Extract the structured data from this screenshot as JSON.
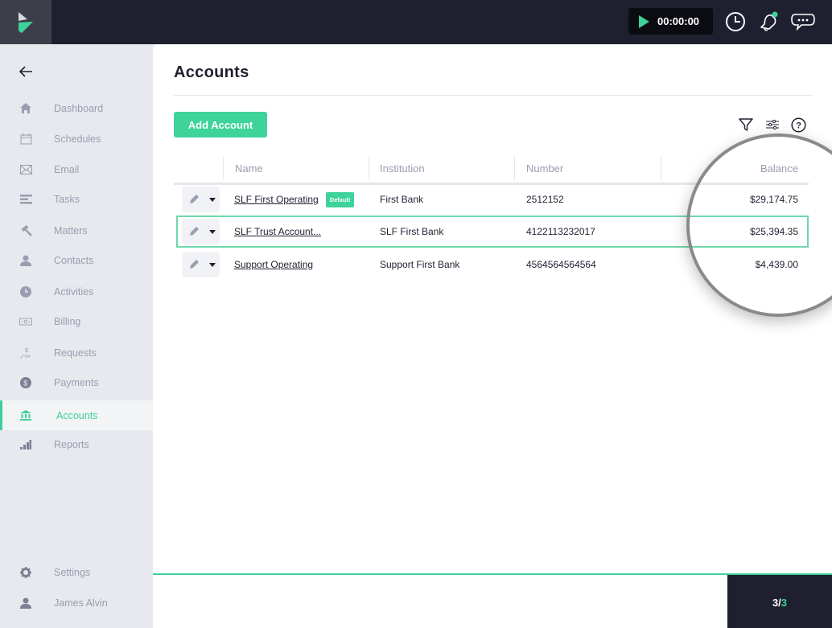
{
  "app": {
    "logo": "play-logo-icon"
  },
  "topbar": {
    "timer": "00:00:00",
    "icons": [
      "play-icon",
      "clock-icon",
      "bell-icon",
      "chat-icon"
    ],
    "notification_dot_color": "#3ed39a"
  },
  "sidebar": {
    "back_icon": "arrow-left-icon",
    "items": [
      {
        "label": "Dashboard",
        "icon": "home-icon"
      },
      {
        "label": "Schedules",
        "icon": "calendar-icon"
      },
      {
        "label": "Email",
        "icon": "envelope-icon"
      },
      {
        "label": "Tasks",
        "icon": "tasks-icon"
      },
      {
        "label": "Matters",
        "icon": "gavel-icon"
      },
      {
        "label": "Contacts",
        "icon": "person-icon"
      },
      {
        "label": "Activities",
        "icon": "clock-icon"
      },
      {
        "label": "Billing",
        "icon": "bill-icon"
      },
      {
        "label": "Requests",
        "icon": "hand-dollar-icon"
      },
      {
        "label": "Payments",
        "icon": "dollar-coin-icon"
      },
      {
        "label": "Accounts",
        "icon": "bank-icon",
        "active": true
      },
      {
        "label": "Reports",
        "icon": "bar-chart-icon"
      }
    ],
    "bottom_items": [
      {
        "label": "Settings",
        "icon": "gear-icon"
      },
      {
        "label": "James Alvin",
        "icon": "user-icon"
      }
    ]
  },
  "main": {
    "title": "Accounts",
    "add_button": "Add Account",
    "toolbar_icons": [
      "filter-icon",
      "sliders-icon",
      "help-icon"
    ],
    "table": {
      "columns": [
        "Name",
        "Institution",
        "Number",
        "Balance"
      ],
      "rows": [
        {
          "name": "SLF First Operating",
          "badge": "Default",
          "institution": "First Bank",
          "number": "2512152",
          "balance": "$29,174.75",
          "selected": false
        },
        {
          "name": "SLF Trust Account...",
          "badge": null,
          "institution": "SLF First Bank",
          "number": "4122113232017",
          "balance": "$25,394.35",
          "selected": true
        },
        {
          "name": "Support Operating",
          "badge": null,
          "institution": "Support First Bank",
          "number": "4564564564564",
          "balance": "$4,439.00",
          "selected": false
        }
      ]
    }
  },
  "footer": {
    "step_current": "3/",
    "step_total": "3"
  },
  "colors": {
    "accent": "#3ed39a",
    "topbar": "#1e2030",
    "sidebar": "#e8e9ee"
  }
}
